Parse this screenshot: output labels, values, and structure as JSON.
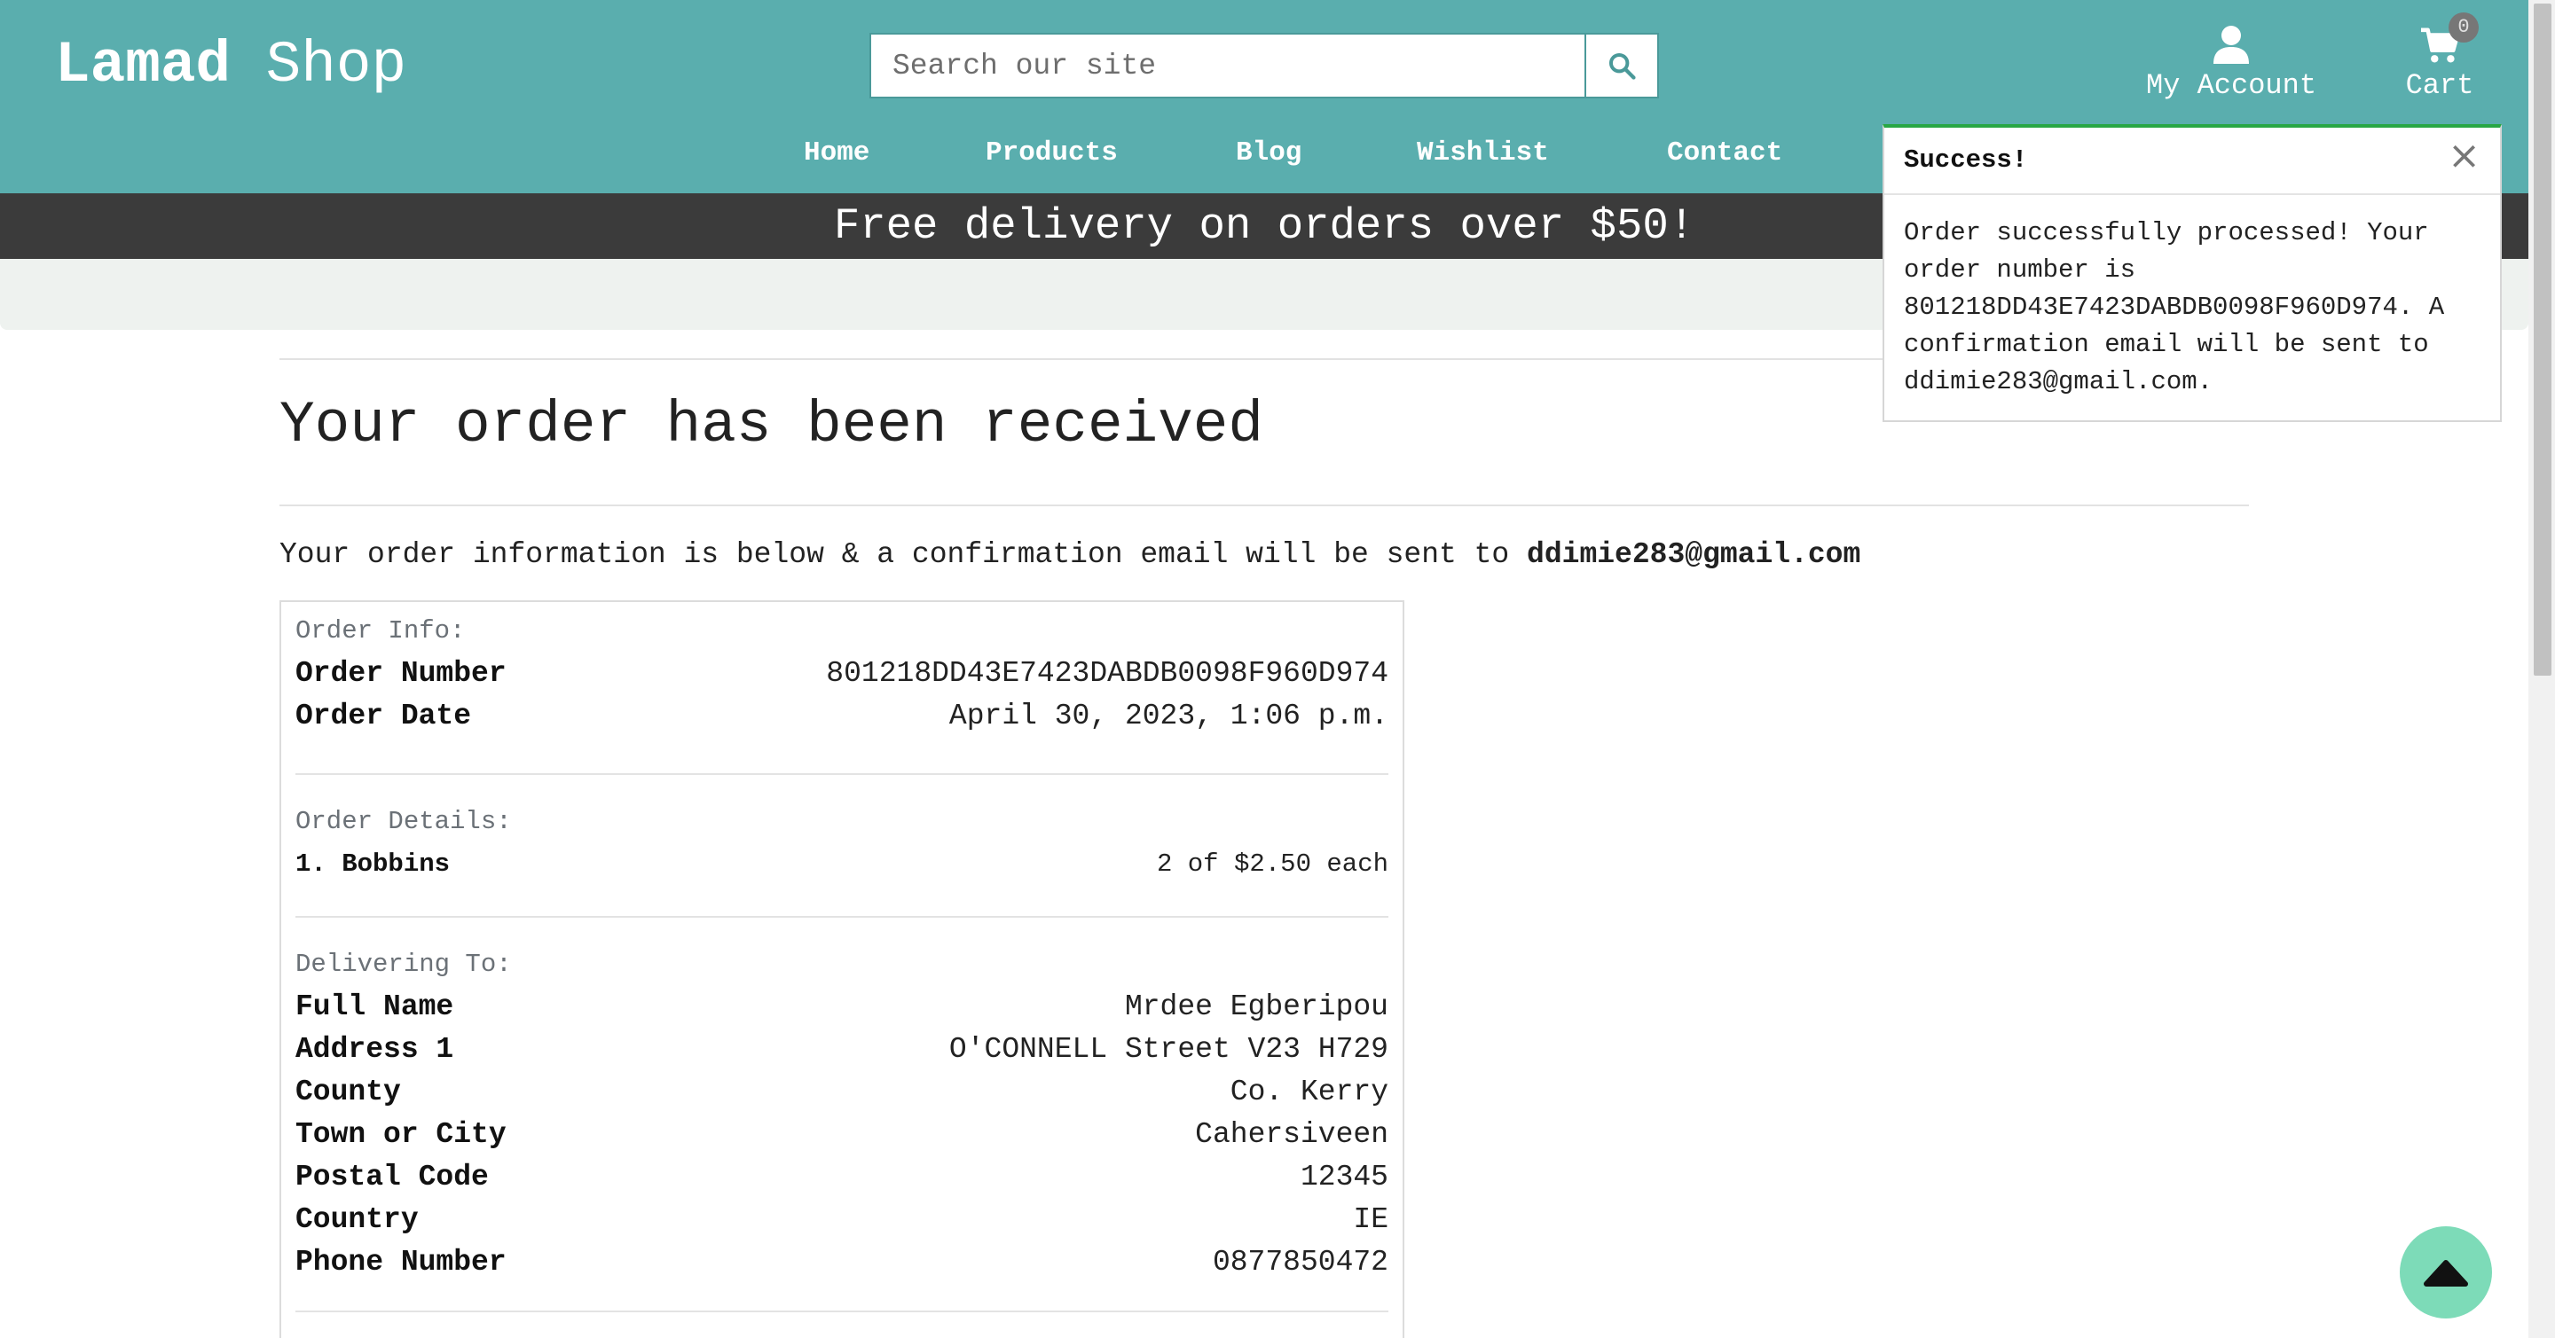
{
  "header": {
    "logo_bold": "Lamad",
    "logo_rest": "Shop",
    "search_placeholder": "Search our site",
    "account_label": "My Account",
    "cart_label": "Cart",
    "cart_count": "0",
    "icons": {
      "search": "search-icon",
      "account": "user-icon",
      "cart": "cart-icon"
    },
    "colors": {
      "header_bg": "#5aaeae",
      "promo_bg": "#3b3b3b",
      "accent_green": "#28a745",
      "back_to_top": "#7ddbb8"
    }
  },
  "nav": {
    "items": [
      {
        "label": "Home"
      },
      {
        "label": "Products"
      },
      {
        "label": "Blog"
      },
      {
        "label": "Wishlist"
      },
      {
        "label": "Contact"
      }
    ]
  },
  "promo": {
    "text": "Free delivery on orders over $50!"
  },
  "toast": {
    "title": "Success!",
    "close": "×",
    "lines": [
      "Order successfully processed! Your",
      "order number is",
      "801218DD43E7423DABDB0098F960D974. A",
      "confirmation email will be sent to",
      "ddimie283@gmail.com."
    ]
  },
  "main": {
    "title": "Your order has been received",
    "intro_text": "Your order information is below & a confirmation email will be sent to ",
    "intro_email": "ddimie283@gmail.com"
  },
  "order": {
    "info_title": "Order Info:",
    "info": [
      {
        "key": "Order Number",
        "value": "801218DD43E7423DABDB0098F960D974"
      },
      {
        "key": "Order Date",
        "value": "April 30, 2023, 1:06 p.m."
      }
    ],
    "details_title": "Order Details:",
    "details": [
      {
        "key": "1. Bobbins",
        "value": "2 of $2.50 each"
      }
    ],
    "delivery_title": "Delivering To:",
    "delivery": [
      {
        "key": "Full Name",
        "value": "Mrdee Egberipou"
      },
      {
        "key": "Address 1",
        "value": "O'CONNELL Street V23 H729"
      },
      {
        "key": "County",
        "value": "Co. Kerry"
      },
      {
        "key": "Town or City",
        "value": "Cahersiveen"
      },
      {
        "key": "Postal Code",
        "value": "12345"
      },
      {
        "key": "Country",
        "value": "IE"
      },
      {
        "key": "Phone Number",
        "value": "0877850472"
      }
    ]
  },
  "back_to_top_icon": "caret-up-icon"
}
